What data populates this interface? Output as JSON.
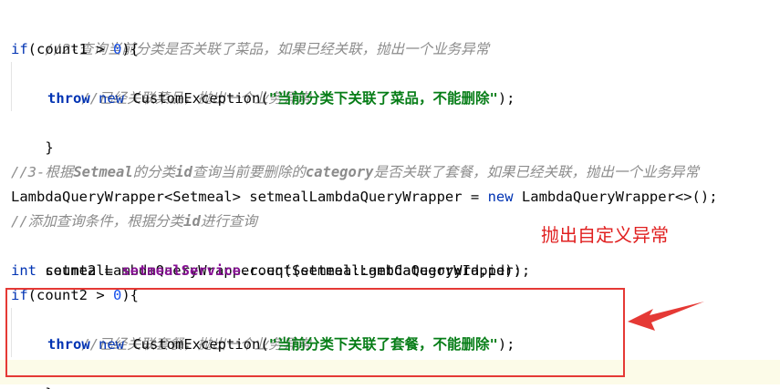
{
  "code": {
    "l1": {
      "comment": "//2-查询当前分类是否关联了菜品，如果已经关联，抛出一个业务异常"
    },
    "l2": {
      "kw": "if",
      "p1": "(count1 > ",
      "num": "0",
      "p2": "){"
    },
    "l3": {
      "comment": "//已经关联菜品，抛出一个业务异常"
    },
    "l4": {
      "kw1": "throw",
      "kw2": "new",
      "p1": " CustomException(",
      "str": "\"当前分类下关联了菜品，不能删除\"",
      "p2": ");"
    },
    "l5": {
      "p": "}"
    },
    "l6": {
      "c1": "//3-根据",
      "cb1": "Setmeal",
      "c2": "的分类",
      "cb2": "id",
      "c3": "查询当前要删除的",
      "cb3": "category",
      "c4": "是否关联了套餐，如果已经关联，抛出一个业务异常"
    },
    "l7": {
      "p1": "LambdaQueryWrapper<Setmeal> setmealLambdaQueryWrapper = ",
      "kw": "new",
      "p2": " LambdaQueryWrapper<>();"
    },
    "l8": {
      "c1": "//添加查询条件，根据分类",
      "cb1": "id",
      "c2": "进行查询"
    },
    "l9": {
      "p": "setmealLambdaQueryWrapper.eq(Setmeal::getCategoryId,id);"
    },
    "l10": {
      "kw": "int",
      "p1": " count2 = ",
      "field": "setmealService",
      "p2": ".count(setmealLambdaQueryWrapper);"
    },
    "l11": {
      "kw": "if",
      "p1": "(count2 > ",
      "num": "0",
      "p2": "){"
    },
    "l12": {
      "comment": "//已经关联套餐，抛出一个业务异常"
    },
    "l13": {
      "kw1": "throw",
      "kw2": "new",
      "p1": " CustomException(",
      "str": "\"当前分类下关联了套餐，不能删除\"",
      "p2": ");"
    },
    "l14": {
      "p": "}"
    }
  },
  "annotation": {
    "label": "抛出自定义异常",
    "color": "#e53935"
  },
  "colors": {
    "keyword": "#0033b3",
    "comment": "#8c8c8c",
    "string": "#067d17",
    "number": "#1750eb",
    "field": "#871094",
    "current_line": "#fcfbe8"
  }
}
